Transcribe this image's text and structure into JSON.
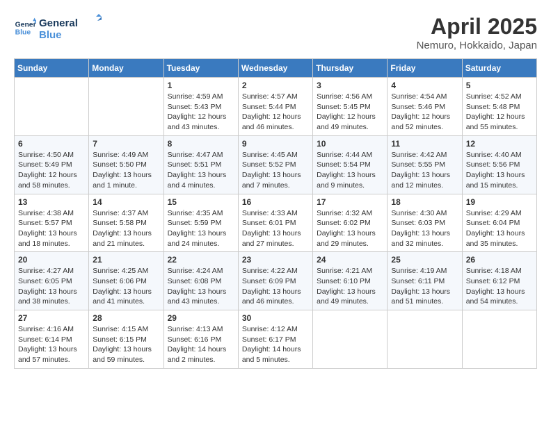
{
  "header": {
    "logo_line1": "General",
    "logo_line2": "Blue",
    "month": "April 2025",
    "location": "Nemuro, Hokkaido, Japan"
  },
  "weekdays": [
    "Sunday",
    "Monday",
    "Tuesday",
    "Wednesday",
    "Thursday",
    "Friday",
    "Saturday"
  ],
  "weeks": [
    [
      {
        "day": "",
        "content": ""
      },
      {
        "day": "",
        "content": ""
      },
      {
        "day": "1",
        "content": "Sunrise: 4:59 AM\nSunset: 5:43 PM\nDaylight: 12 hours and 43 minutes."
      },
      {
        "day": "2",
        "content": "Sunrise: 4:57 AM\nSunset: 5:44 PM\nDaylight: 12 hours and 46 minutes."
      },
      {
        "day": "3",
        "content": "Sunrise: 4:56 AM\nSunset: 5:45 PM\nDaylight: 12 hours and 49 minutes."
      },
      {
        "day": "4",
        "content": "Sunrise: 4:54 AM\nSunset: 5:46 PM\nDaylight: 12 hours and 52 minutes."
      },
      {
        "day": "5",
        "content": "Sunrise: 4:52 AM\nSunset: 5:48 PM\nDaylight: 12 hours and 55 minutes."
      }
    ],
    [
      {
        "day": "6",
        "content": "Sunrise: 4:50 AM\nSunset: 5:49 PM\nDaylight: 12 hours and 58 minutes."
      },
      {
        "day": "7",
        "content": "Sunrise: 4:49 AM\nSunset: 5:50 PM\nDaylight: 13 hours and 1 minute."
      },
      {
        "day": "8",
        "content": "Sunrise: 4:47 AM\nSunset: 5:51 PM\nDaylight: 13 hours and 4 minutes."
      },
      {
        "day": "9",
        "content": "Sunrise: 4:45 AM\nSunset: 5:52 PM\nDaylight: 13 hours and 7 minutes."
      },
      {
        "day": "10",
        "content": "Sunrise: 4:44 AM\nSunset: 5:54 PM\nDaylight: 13 hours and 9 minutes."
      },
      {
        "day": "11",
        "content": "Sunrise: 4:42 AM\nSunset: 5:55 PM\nDaylight: 13 hours and 12 minutes."
      },
      {
        "day": "12",
        "content": "Sunrise: 4:40 AM\nSunset: 5:56 PM\nDaylight: 13 hours and 15 minutes."
      }
    ],
    [
      {
        "day": "13",
        "content": "Sunrise: 4:38 AM\nSunset: 5:57 PM\nDaylight: 13 hours and 18 minutes."
      },
      {
        "day": "14",
        "content": "Sunrise: 4:37 AM\nSunset: 5:58 PM\nDaylight: 13 hours and 21 minutes."
      },
      {
        "day": "15",
        "content": "Sunrise: 4:35 AM\nSunset: 5:59 PM\nDaylight: 13 hours and 24 minutes."
      },
      {
        "day": "16",
        "content": "Sunrise: 4:33 AM\nSunset: 6:01 PM\nDaylight: 13 hours and 27 minutes."
      },
      {
        "day": "17",
        "content": "Sunrise: 4:32 AM\nSunset: 6:02 PM\nDaylight: 13 hours and 29 minutes."
      },
      {
        "day": "18",
        "content": "Sunrise: 4:30 AM\nSunset: 6:03 PM\nDaylight: 13 hours and 32 minutes."
      },
      {
        "day": "19",
        "content": "Sunrise: 4:29 AM\nSunset: 6:04 PM\nDaylight: 13 hours and 35 minutes."
      }
    ],
    [
      {
        "day": "20",
        "content": "Sunrise: 4:27 AM\nSunset: 6:05 PM\nDaylight: 13 hours and 38 minutes."
      },
      {
        "day": "21",
        "content": "Sunrise: 4:25 AM\nSunset: 6:06 PM\nDaylight: 13 hours and 41 minutes."
      },
      {
        "day": "22",
        "content": "Sunrise: 4:24 AM\nSunset: 6:08 PM\nDaylight: 13 hours and 43 minutes."
      },
      {
        "day": "23",
        "content": "Sunrise: 4:22 AM\nSunset: 6:09 PM\nDaylight: 13 hours and 46 minutes."
      },
      {
        "day": "24",
        "content": "Sunrise: 4:21 AM\nSunset: 6:10 PM\nDaylight: 13 hours and 49 minutes."
      },
      {
        "day": "25",
        "content": "Sunrise: 4:19 AM\nSunset: 6:11 PM\nDaylight: 13 hours and 51 minutes."
      },
      {
        "day": "26",
        "content": "Sunrise: 4:18 AM\nSunset: 6:12 PM\nDaylight: 13 hours and 54 minutes."
      }
    ],
    [
      {
        "day": "27",
        "content": "Sunrise: 4:16 AM\nSunset: 6:14 PM\nDaylight: 13 hours and 57 minutes."
      },
      {
        "day": "28",
        "content": "Sunrise: 4:15 AM\nSunset: 6:15 PM\nDaylight: 13 hours and 59 minutes."
      },
      {
        "day": "29",
        "content": "Sunrise: 4:13 AM\nSunset: 6:16 PM\nDaylight: 14 hours and 2 minutes."
      },
      {
        "day": "30",
        "content": "Sunrise: 4:12 AM\nSunset: 6:17 PM\nDaylight: 14 hours and 5 minutes."
      },
      {
        "day": "",
        "content": ""
      },
      {
        "day": "",
        "content": ""
      },
      {
        "day": "",
        "content": ""
      }
    ]
  ]
}
